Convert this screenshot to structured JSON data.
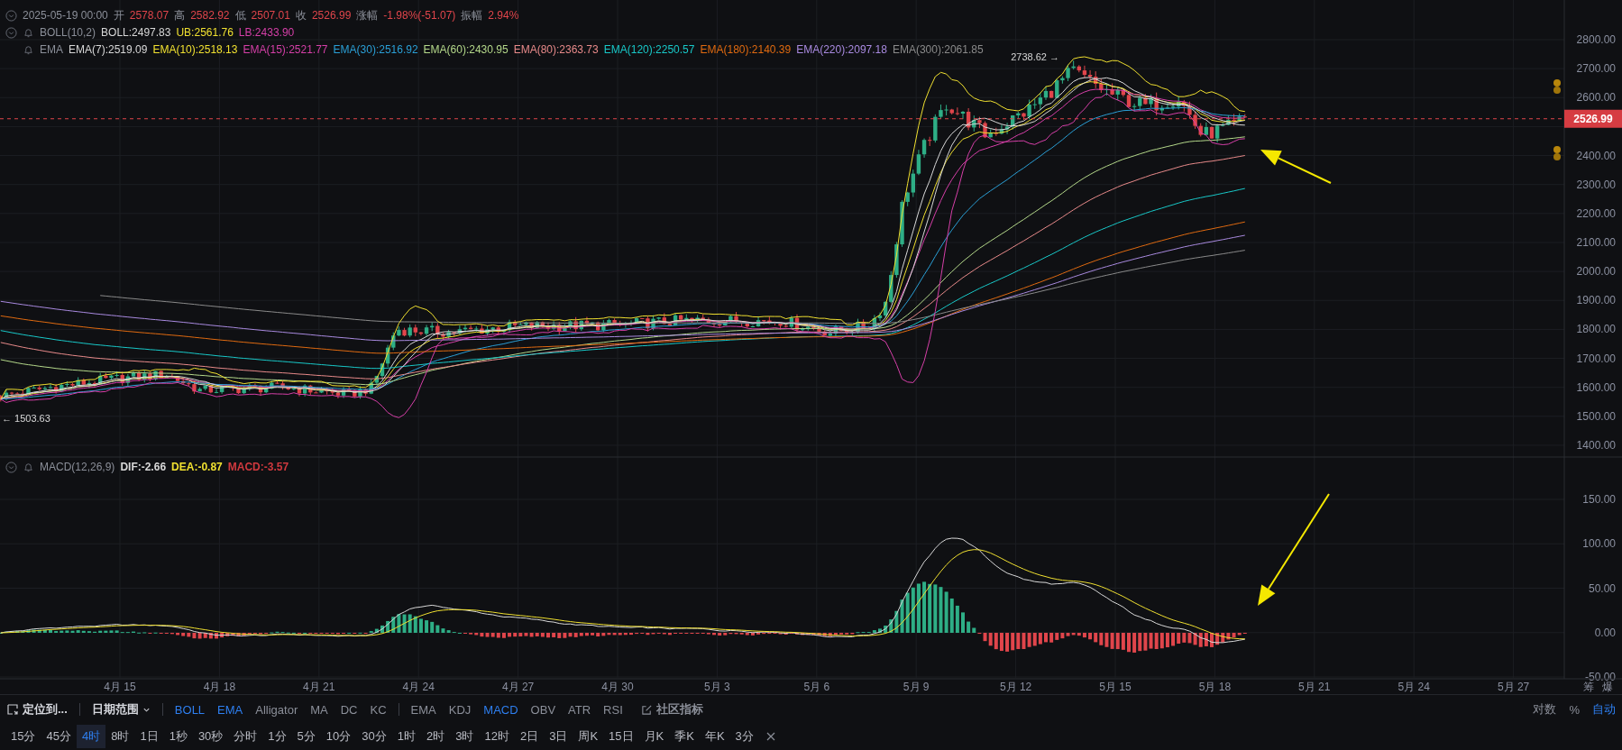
{
  "ohlc_bar": {
    "date": "2025-05-19 00:00",
    "fields": [
      {
        "label": "开",
        "value": "2578.07"
      },
      {
        "label": "高",
        "value": "2582.92"
      },
      {
        "label": "低",
        "value": "2507.01"
      },
      {
        "label": "收",
        "value": "2526.99"
      },
      {
        "label": "涨幅",
        "value": "-1.98%(-51.07)"
      },
      {
        "label": "振幅",
        "value": "2.94%"
      }
    ]
  },
  "indicators": [
    {
      "name": "BOLL(10,2)",
      "values": [
        {
          "text": "BOLL:2497.83",
          "color": "#d8d8d8"
        },
        {
          "text": "UB:2561.76",
          "color": "#f0e030"
        },
        {
          "text": "LB:2433.90",
          "color": "#d63fa8"
        }
      ]
    },
    {
      "name": "EMA",
      "values": [
        {
          "text": "EMA(7):2519.09",
          "color": "#d8d8d8"
        },
        {
          "text": "EMA(10):2518.13",
          "color": "#f0e030"
        },
        {
          "text": "EMA(15):2521.77",
          "color": "#d63fa8"
        },
        {
          "text": "EMA(30):2516.92",
          "color": "#2a9fd6"
        },
        {
          "text": "EMA(60):2430.95",
          "color": "#b4d88a"
        },
        {
          "text": "EMA(80):2363.73",
          "color": "#e88a8a"
        },
        {
          "text": "EMA(120):2250.57",
          "color": "#18c8c8"
        },
        {
          "text": "EMA(180):2140.39",
          "color": "#e06a10"
        },
        {
          "text": "EMA(220):2097.18",
          "color": "#a98ae0"
        },
        {
          "text": "EMA(300):2061.85",
          "color": "#8a8a8a"
        }
      ]
    }
  ],
  "price_axis": {
    "ticks": [
      "2800.00",
      "2700.00",
      "2600.00",
      "2400.00",
      "2300.00",
      "2200.00",
      "2100.00",
      "2000.00",
      "1900.00",
      "1800.00",
      "1700.00",
      "1600.00",
      "1500.00",
      "1400.00"
    ],
    "current_price": "2526.99"
  },
  "annotations": {
    "high": "2738.62 →",
    "low": "← 1503.63"
  },
  "macd": {
    "name": "MACD(12,26,9)",
    "values": [
      {
        "text": "DIF:-2.66",
        "color": "#d8d8d8"
      },
      {
        "text": "DEA:-0.87",
        "color": "#f0e030"
      },
      {
        "text": "MACD:-3.57",
        "color": "#d0393e"
      }
    ],
    "ticks": [
      "150.00",
      "100.00",
      "50.00",
      "0.00",
      "-50.00"
    ]
  },
  "time_axis": [
    "4月 15",
    "4月 18",
    "4月 21",
    "4月 24",
    "4月 27",
    "4月 30",
    "5月 3",
    "5月 6",
    "5月 9",
    "5月 12",
    "5月 15",
    "5月 18",
    "5月 21",
    "5月 24",
    "5月 27"
  ],
  "axis_corner": [
    "筹",
    "爆"
  ],
  "toolbar": {
    "locate": "定位到...",
    "date_range": "日期范围",
    "indicator_groups": [
      [
        {
          "label": "BOLL",
          "selected": true
        },
        {
          "label": "EMA",
          "selected": true
        },
        {
          "label": "Alligator",
          "selected": false
        },
        {
          "label": "MA",
          "selected": false
        },
        {
          "label": "DC",
          "selected": false
        },
        {
          "label": "KC",
          "selected": false
        }
      ],
      [
        {
          "label": "EMA",
          "selected": false
        },
        {
          "label": "KDJ",
          "selected": false
        },
        {
          "label": "MACD",
          "selected": true
        },
        {
          "label": "OBV",
          "selected": false
        },
        {
          "label": "ATR",
          "selected": false
        },
        {
          "label": "RSI",
          "selected": false
        }
      ]
    ],
    "community": "社区指标",
    "scale_options": [
      {
        "label": "对数",
        "selected": false
      },
      {
        "label": "%",
        "selected": false
      },
      {
        "label": "自动",
        "selected": true
      }
    ]
  },
  "timeframes": [
    {
      "label": "15分",
      "selected": false
    },
    {
      "label": "45分",
      "selected": false
    },
    {
      "label": "4时",
      "selected": true
    },
    {
      "label": "8时",
      "selected": false
    },
    {
      "label": "1日",
      "selected": false
    },
    {
      "label": "1秒",
      "selected": false
    },
    {
      "label": "30秒",
      "selected": false
    },
    {
      "label": "分时",
      "selected": false
    },
    {
      "label": "1分",
      "selected": false
    },
    {
      "label": "5分",
      "selected": false
    },
    {
      "label": "10分",
      "selected": false
    },
    {
      "label": "30分",
      "selected": false
    },
    {
      "label": "1时",
      "selected": false
    },
    {
      "label": "2时",
      "selected": false
    },
    {
      "label": "3时",
      "selected": false
    },
    {
      "label": "12时",
      "selected": false
    },
    {
      "label": "2日",
      "selected": false
    },
    {
      "label": "3日",
      "selected": false
    },
    {
      "label": "周K",
      "selected": false
    },
    {
      "label": "15日",
      "selected": false
    },
    {
      "label": "月K",
      "selected": false
    },
    {
      "label": "季K",
      "selected": false
    },
    {
      "label": "年K",
      "selected": false
    },
    {
      "label": "3分",
      "selected": false
    }
  ]
}
